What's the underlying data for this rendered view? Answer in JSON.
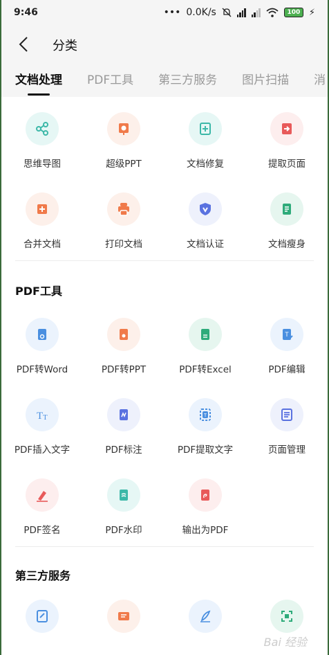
{
  "status_bar": {
    "time": "9:46",
    "network_speed": "0.0K/s",
    "battery": "100"
  },
  "header": {
    "title": "分类"
  },
  "tabs": [
    {
      "label": "文档处理",
      "active": true
    },
    {
      "label": "PDF工具",
      "active": false
    },
    {
      "label": "第三方服务",
      "active": false
    },
    {
      "label": "图片扫描",
      "active": false
    },
    {
      "label": "消",
      "active": false
    }
  ],
  "doc_section": {
    "items": [
      {
        "label": "思维导图",
        "icon": "mindmap-icon",
        "color": "#3cb8a8",
        "bg": "#e6f7f5"
      },
      {
        "label": "超级PPT",
        "icon": "ppt-icon",
        "color": "#f07a4a",
        "bg": "#fdf0ea"
      },
      {
        "label": "文档修复",
        "icon": "doc-repair-icon",
        "color": "#3cb8a8",
        "bg": "#e6f7f5"
      },
      {
        "label": "提取页面",
        "icon": "extract-page-icon",
        "color": "#e85a5a",
        "bg": "#fdeeee"
      },
      {
        "label": "合并文档",
        "icon": "merge-doc-icon",
        "color": "#f07a4a",
        "bg": "#fdf0ea"
      },
      {
        "label": "打印文档",
        "icon": "print-icon",
        "color": "#f07a4a",
        "bg": "#fdf0ea"
      },
      {
        "label": "文档认证",
        "icon": "verify-icon",
        "color": "#5a72e0",
        "bg": "#eef1fc"
      },
      {
        "label": "文档瘦身",
        "icon": "slim-doc-icon",
        "color": "#2eab7a",
        "bg": "#e6f6ef"
      }
    ]
  },
  "pdf_section": {
    "title": "PDF工具",
    "items": [
      {
        "label": "PDF转Word",
        "icon": "pdf-to-word-icon",
        "color": "#4a8fe0",
        "bg": "#ebf3fd"
      },
      {
        "label": "PDF转PPT",
        "icon": "pdf-to-ppt-icon",
        "color": "#f07a4a",
        "bg": "#fdf0ea"
      },
      {
        "label": "PDF转Excel",
        "icon": "pdf-to-excel-icon",
        "color": "#2eab7a",
        "bg": "#e6f6ef"
      },
      {
        "label": "PDF编辑",
        "icon": "pdf-edit-icon",
        "color": "#4a8fe0",
        "bg": "#ebf3fd"
      },
      {
        "label": "PDF插入文字",
        "icon": "insert-text-icon",
        "color": "#4a8fe0",
        "bg": "#ebf3fd"
      },
      {
        "label": "PDF标注",
        "icon": "annotate-icon",
        "color": "#5a72e0",
        "bg": "#eef1fc"
      },
      {
        "label": "PDF提取文字",
        "icon": "extract-text-icon",
        "color": "#4a8fe0",
        "bg": "#ebf3fd"
      },
      {
        "label": "页面管理",
        "icon": "page-manage-icon",
        "color": "#5a72e0",
        "bg": "#eef1fc"
      },
      {
        "label": "PDF签名",
        "icon": "signature-icon",
        "color": "#e85a5a",
        "bg": "#fdeeee"
      },
      {
        "label": "PDF水印",
        "icon": "watermark-icon",
        "color": "#3cb8a8",
        "bg": "#e6f7f5"
      },
      {
        "label": "输出为PDF",
        "icon": "export-pdf-icon",
        "color": "#e85a5a",
        "bg": "#fdeeee"
      }
    ]
  },
  "third_party_section": {
    "title": "第三方服务",
    "items": [
      {
        "label": "",
        "icon": "doc-service-icon",
        "color": "#4a8fe0",
        "bg": "#ebf3fd"
      },
      {
        "label": "",
        "icon": "form-service-icon",
        "color": "#f07a4a",
        "bg": "#fdf0ea"
      },
      {
        "label": "",
        "icon": "sign-service-icon",
        "color": "#4a8fe0",
        "bg": "#ebf3fd"
      },
      {
        "label": "",
        "icon": "scan-service-icon",
        "color": "#2eab7a",
        "bg": "#e6f6ef"
      }
    ]
  }
}
